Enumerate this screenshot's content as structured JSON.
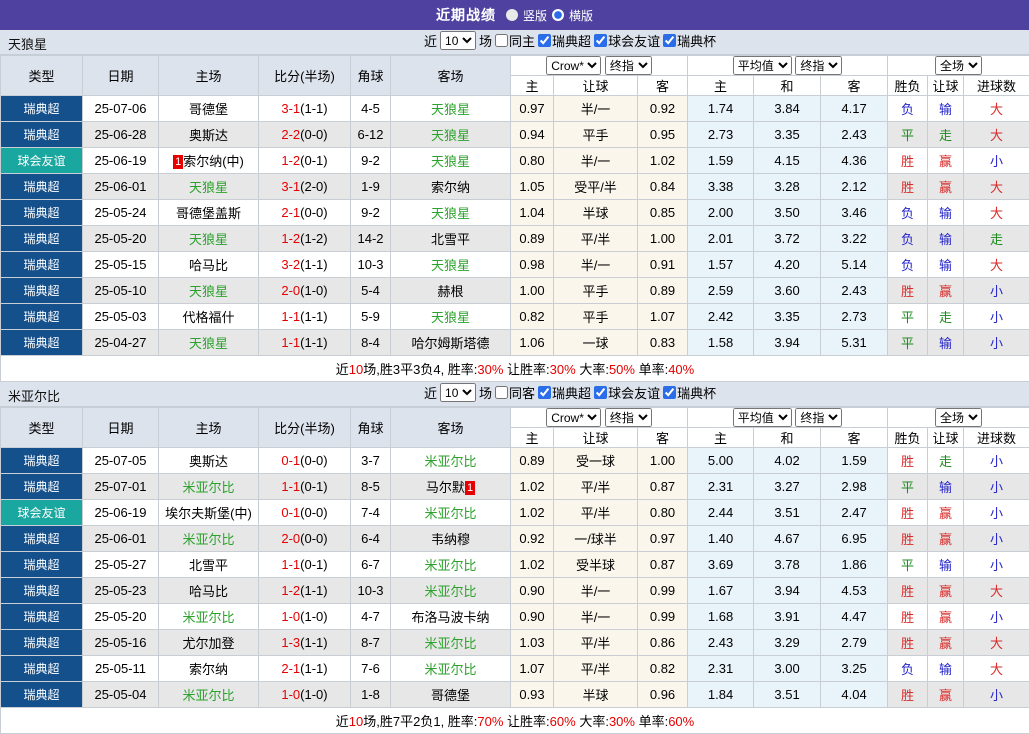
{
  "titlebar": {
    "title": "近期战绩",
    "radio_options": [
      {
        "label": "竖版",
        "selected": false
      },
      {
        "label": "横版",
        "selected": true
      }
    ]
  },
  "filter": {
    "near_label": "近",
    "count": "10",
    "games_label": "场",
    "same_checked": false,
    "leagues": [
      {
        "label": "瑞典超",
        "checked": true
      },
      {
        "label": "球会友谊",
        "checked": true
      },
      {
        "label": "瑞典杯",
        "checked": true
      }
    ]
  },
  "table_header": {
    "type": "类型",
    "date": "日期",
    "home": "主场",
    "score": "比分(半场)",
    "corner": "角球",
    "away": "客场",
    "odds_source": "Crow*",
    "odds_stage": "终指",
    "avg_label": "平均值",
    "avg_stage": "终指",
    "scope": "全场",
    "sub": {
      "home": "主",
      "handicap": "让球",
      "away": "客",
      "avg_home": "主",
      "avg_draw": "和",
      "avg_away": "客",
      "result": "胜负",
      "handicap_result": "让球",
      "goals": "进球数"
    }
  },
  "colors": {
    "topbar_bg": "#4e41a0",
    "header_bg": "#dde3ed",
    "league_bg": "#14508c",
    "friendly_bg": "#19a79f",
    "team_highlight": "#2ca22c",
    "score_red": "#e60000",
    "badge_red": "#e60000",
    "win_red": "#d92b2b",
    "draw_green": "#1d8a1d",
    "lose_blue": "#2525cc"
  },
  "result_color_map": {
    "胜": "win_red",
    "赢": "win_red",
    "大": "win_red",
    "平": "draw_green",
    "走": "draw_green",
    "负": "lose_blue",
    "输": "lose_blue",
    "小": "lose_blue"
  },
  "sections": [
    {
      "team": "天狼星",
      "same_filter_label": "同主",
      "rows": [
        {
          "type": "瑞典超",
          "type_key": "league",
          "date": "25-07-06",
          "home": "哥德堡",
          "home_highlight": false,
          "score": "3-1",
          "half": "(1-1)",
          "corners": "4-5",
          "away": "天狼星",
          "away_highlight": true,
          "odds_home": "0.97",
          "handicap": "半/一",
          "odds_away": "0.92",
          "avg_home": "1.74",
          "avg_draw": "3.84",
          "avg_away": "4.17",
          "result": "负",
          "handicap_result": "输",
          "goals": "大"
        },
        {
          "type": "瑞典超",
          "type_key": "league",
          "date": "25-06-28",
          "home": "奥斯达",
          "home_highlight": false,
          "score": "2-2",
          "half": "(0-0)",
          "corners": "6-12",
          "away": "天狼星",
          "away_highlight": true,
          "odds_home": "0.94",
          "handicap": "平手",
          "odds_away": "0.95",
          "avg_home": "2.73",
          "avg_draw": "3.35",
          "avg_away": "2.43",
          "result": "平",
          "handicap_result": "走",
          "goals": "大"
        },
        {
          "type": "球会友谊",
          "type_key": "friendly",
          "date": "25-06-19",
          "home": "索尔纳(中)",
          "home_badge": "1",
          "home_badge_pos": "before",
          "home_highlight": false,
          "score": "1-2",
          "half": "(0-1)",
          "corners": "9-2",
          "away": "天狼星",
          "away_highlight": true,
          "odds_home": "0.80",
          "handicap": "半/一",
          "odds_away": "1.02",
          "avg_home": "1.59",
          "avg_draw": "4.15",
          "avg_away": "4.36",
          "result": "胜",
          "handicap_result": "赢",
          "goals": "小"
        },
        {
          "type": "瑞典超",
          "type_key": "league",
          "date": "25-06-01",
          "home": "天狼星",
          "home_highlight": true,
          "score": "3-1",
          "half": "(2-0)",
          "corners": "1-9",
          "away": "索尔纳",
          "away_highlight": false,
          "odds_home": "1.05",
          "handicap": "受平/半",
          "odds_away": "0.84",
          "avg_home": "3.38",
          "avg_draw": "3.28",
          "avg_away": "2.12",
          "result": "胜",
          "handicap_result": "赢",
          "goals": "大"
        },
        {
          "type": "瑞典超",
          "type_key": "league",
          "date": "25-05-24",
          "home": "哥德堡盖斯",
          "home_highlight": false,
          "score": "2-1",
          "half": "(0-0)",
          "corners": "9-2",
          "away": "天狼星",
          "away_highlight": true,
          "odds_home": "1.04",
          "handicap": "半球",
          "odds_away": "0.85",
          "avg_home": "2.00",
          "avg_draw": "3.50",
          "avg_away": "3.46",
          "result": "负",
          "handicap_result": "输",
          "goals": "大"
        },
        {
          "type": "瑞典超",
          "type_key": "league",
          "date": "25-05-20",
          "home": "天狼星",
          "home_highlight": true,
          "score": "1-2",
          "half": "(1-2)",
          "corners": "14-2",
          "away": "北雪平",
          "away_highlight": false,
          "odds_home": "0.89",
          "handicap": "平/半",
          "odds_away": "1.00",
          "avg_home": "2.01",
          "avg_draw": "3.72",
          "avg_away": "3.22",
          "result": "负",
          "handicap_result": "输",
          "goals": "走"
        },
        {
          "type": "瑞典超",
          "type_key": "league",
          "date": "25-05-15",
          "home": "哈马比",
          "home_highlight": false,
          "score": "3-2",
          "half": "(1-1)",
          "corners": "10-3",
          "away": "天狼星",
          "away_highlight": true,
          "odds_home": "0.98",
          "handicap": "半/一",
          "odds_away": "0.91",
          "avg_home": "1.57",
          "avg_draw": "4.20",
          "avg_away": "5.14",
          "result": "负",
          "handicap_result": "输",
          "goals": "大"
        },
        {
          "type": "瑞典超",
          "type_key": "league",
          "date": "25-05-10",
          "home": "天狼星",
          "home_highlight": true,
          "score": "2-0",
          "half": "(1-0)",
          "corners": "5-4",
          "away": "赫根",
          "away_highlight": false,
          "odds_home": "1.00",
          "handicap": "平手",
          "odds_away": "0.89",
          "avg_home": "2.59",
          "avg_draw": "3.60",
          "avg_away": "2.43",
          "result": "胜",
          "handicap_result": "赢",
          "goals": "小"
        },
        {
          "type": "瑞典超",
          "type_key": "league",
          "date": "25-05-03",
          "home": "代格福什",
          "home_highlight": false,
          "score": "1-1",
          "half": "(1-1)",
          "corners": "5-9",
          "away": "天狼星",
          "away_highlight": true,
          "odds_home": "0.82",
          "handicap": "平手",
          "odds_away": "1.07",
          "avg_home": "2.42",
          "avg_draw": "3.35",
          "avg_away": "2.73",
          "result": "平",
          "handicap_result": "走",
          "goals": "小"
        },
        {
          "type": "瑞典超",
          "type_key": "league",
          "date": "25-04-27",
          "home": "天狼星",
          "home_highlight": true,
          "score": "1-1",
          "half": "(1-1)",
          "corners": "8-4",
          "away": "哈尔姆斯塔德",
          "away_highlight": false,
          "odds_home": "1.06",
          "handicap": "一球",
          "odds_away": "0.83",
          "avg_home": "1.58",
          "avg_draw": "3.94",
          "avg_away": "5.31",
          "result": "平",
          "handicap_result": "输",
          "goals": "小"
        }
      ],
      "summary_segments": [
        {
          "text": "近"
        },
        {
          "text": "10",
          "red": true
        },
        {
          "text": "场,胜3平3负4, 胜率:"
        },
        {
          "text": "30%",
          "red": true
        },
        {
          "text": " 让胜率:"
        },
        {
          "text": "30%",
          "red": true
        },
        {
          "text": " 大率:"
        },
        {
          "text": "50%",
          "red": true
        },
        {
          "text": " 单率:"
        },
        {
          "text": "40%",
          "red": true
        }
      ]
    },
    {
      "team": "米亚尔比",
      "same_filter_label": "同客",
      "rows": [
        {
          "type": "瑞典超",
          "type_key": "league",
          "date": "25-07-05",
          "home": "奥斯达",
          "home_highlight": false,
          "score": "0-1",
          "half": "(0-0)",
          "corners": "3-7",
          "away": "米亚尔比",
          "away_highlight": true,
          "odds_home": "0.89",
          "handicap": "受一球",
          "odds_away": "1.00",
          "avg_home": "5.00",
          "avg_draw": "4.02",
          "avg_away": "1.59",
          "result": "胜",
          "handicap_result": "走",
          "goals": "小"
        },
        {
          "type": "瑞典超",
          "type_key": "league",
          "date": "25-07-01",
          "home": "米亚尔比",
          "home_highlight": true,
          "score": "1-1",
          "half": "(0-1)",
          "corners": "8-5",
          "away": "马尔默",
          "away_badge": "1",
          "away_badge_pos": "after",
          "away_highlight": false,
          "odds_home": "1.02",
          "handicap": "平/半",
          "odds_away": "0.87",
          "avg_home": "2.31",
          "avg_draw": "3.27",
          "avg_away": "2.98",
          "result": "平",
          "handicap_result": "输",
          "goals": "小"
        },
        {
          "type": "球会友谊",
          "type_key": "friendly",
          "date": "25-06-19",
          "home": "埃尔夫斯堡(中)",
          "home_highlight": false,
          "score": "0-1",
          "half": "(0-0)",
          "corners": "7-4",
          "away": "米亚尔比",
          "away_highlight": true,
          "odds_home": "1.02",
          "handicap": "平/半",
          "odds_away": "0.80",
          "avg_home": "2.44",
          "avg_draw": "3.51",
          "avg_away": "2.47",
          "result": "胜",
          "handicap_result": "赢",
          "goals": "小"
        },
        {
          "type": "瑞典超",
          "type_key": "league",
          "date": "25-06-01",
          "home": "米亚尔比",
          "home_highlight": true,
          "score": "2-0",
          "half": "(0-0)",
          "corners": "6-4",
          "away": "韦纳穆",
          "away_highlight": false,
          "odds_home": "0.92",
          "handicap": "一/球半",
          "odds_away": "0.97",
          "avg_home": "1.40",
          "avg_draw": "4.67",
          "avg_away": "6.95",
          "result": "胜",
          "handicap_result": "赢",
          "goals": "小"
        },
        {
          "type": "瑞典超",
          "type_key": "league",
          "date": "25-05-27",
          "home": "北雪平",
          "home_highlight": false,
          "score": "1-1",
          "half": "(0-1)",
          "corners": "6-7",
          "away": "米亚尔比",
          "away_highlight": true,
          "odds_home": "1.02",
          "handicap": "受半球",
          "odds_away": "0.87",
          "avg_home": "3.69",
          "avg_draw": "3.78",
          "avg_away": "1.86",
          "result": "平",
          "handicap_result": "输",
          "goals": "小"
        },
        {
          "type": "瑞典超",
          "type_key": "league",
          "date": "25-05-23",
          "home": "哈马比",
          "home_highlight": false,
          "score": "1-2",
          "half": "(1-1)",
          "corners": "10-3",
          "away": "米亚尔比",
          "away_highlight": true,
          "odds_home": "0.90",
          "handicap": "半/一",
          "odds_away": "0.99",
          "avg_home": "1.67",
          "avg_draw": "3.94",
          "avg_away": "4.53",
          "result": "胜",
          "handicap_result": "赢",
          "goals": "大"
        },
        {
          "type": "瑞典超",
          "type_key": "league",
          "date": "25-05-20",
          "home": "米亚尔比",
          "home_highlight": true,
          "score": "1-0",
          "half": "(1-0)",
          "corners": "4-7",
          "away": "布洛马波卡纳",
          "away_highlight": false,
          "odds_home": "0.90",
          "handicap": "半/一",
          "odds_away": "0.99",
          "avg_home": "1.68",
          "avg_draw": "3.91",
          "avg_away": "4.47",
          "result": "胜",
          "handicap_result": "赢",
          "goals": "小"
        },
        {
          "type": "瑞典超",
          "type_key": "league",
          "date": "25-05-16",
          "home": "尤尔加登",
          "home_highlight": false,
          "score": "1-3",
          "half": "(1-1)",
          "corners": "8-7",
          "away": "米亚尔比",
          "away_highlight": true,
          "odds_home": "1.03",
          "handicap": "平/半",
          "odds_away": "0.86",
          "avg_home": "2.43",
          "avg_draw": "3.29",
          "avg_away": "2.79",
          "result": "胜",
          "handicap_result": "赢",
          "goals": "大"
        },
        {
          "type": "瑞典超",
          "type_key": "league",
          "date": "25-05-11",
          "home": "索尔纳",
          "home_highlight": false,
          "score": "2-1",
          "half": "(1-1)",
          "corners": "7-6",
          "away": "米亚尔比",
          "away_highlight": true,
          "odds_home": "1.07",
          "handicap": "平/半",
          "odds_away": "0.82",
          "avg_home": "2.31",
          "avg_draw": "3.00",
          "avg_away": "3.25",
          "result": "负",
          "handicap_result": "输",
          "goals": "大"
        },
        {
          "type": "瑞典超",
          "type_key": "league",
          "date": "25-05-04",
          "home": "米亚尔比",
          "home_highlight": true,
          "score": "1-0",
          "half": "(1-0)",
          "corners": "1-8",
          "away": "哥德堡",
          "away_highlight": false,
          "odds_home": "0.93",
          "handicap": "半球",
          "odds_away": "0.96",
          "avg_home": "1.84",
          "avg_draw": "3.51",
          "avg_away": "4.04",
          "result": "胜",
          "handicap_result": "赢",
          "goals": "小"
        }
      ],
      "summary_segments": [
        {
          "text": "近"
        },
        {
          "text": "10",
          "red": true
        },
        {
          "text": "场,胜7平2负1, 胜率:"
        },
        {
          "text": "70%",
          "red": true
        },
        {
          "text": " 让胜率:"
        },
        {
          "text": "60%",
          "red": true
        },
        {
          "text": " 大率:"
        },
        {
          "text": "30%",
          "red": true
        },
        {
          "text": " 单率:"
        },
        {
          "text": "60%",
          "red": true
        }
      ]
    }
  ]
}
